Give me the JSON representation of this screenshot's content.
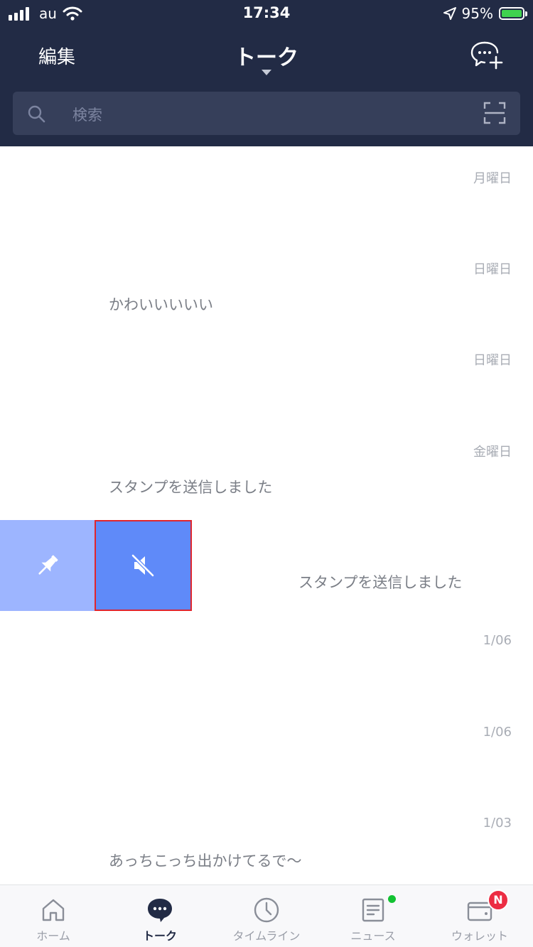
{
  "status_bar": {
    "carrier": "au",
    "time": "17:34",
    "battery_percent": "95%"
  },
  "header": {
    "edit_label": "編集",
    "title": "トーク"
  },
  "search": {
    "placeholder": "検索"
  },
  "chats": [
    {
      "time": "月曜日",
      "preview": ""
    },
    {
      "time": "日曜日",
      "preview": "かわいいいいい"
    },
    {
      "time": "日曜日",
      "preview": ""
    },
    {
      "time": "金曜日",
      "preview": "スタンプを送信しました"
    },
    {
      "time": "",
      "preview": "スタンプを送信しました"
    },
    {
      "time": "1/06",
      "preview": ""
    },
    {
      "time": "1/06",
      "preview": ""
    },
    {
      "time": "1/03",
      "preview": "あっちこっち出かけてるで〜"
    }
  ],
  "swipe_actions": {
    "pin_icon": "pin-icon",
    "mute_icon": "mute-icon"
  },
  "tabs": [
    {
      "label": "ホーム",
      "icon": "home-icon"
    },
    {
      "label": "トーク",
      "icon": "chat-icon",
      "active": true
    },
    {
      "label": "タイムライン",
      "icon": "clock-icon"
    },
    {
      "label": "ニュース",
      "icon": "news-icon"
    },
    {
      "label": "ウォレット",
      "icon": "wallet-icon",
      "badge": "N"
    }
  ],
  "colors": {
    "header_bg": "#222b45",
    "search_bg": "#363f5a",
    "pin_action_bg": "#9db5ff",
    "mute_action_bg": "#5f8af9",
    "highlight_border": "#e0252c",
    "badge_red": "#ec2d43",
    "news_dot": "#12c232"
  }
}
